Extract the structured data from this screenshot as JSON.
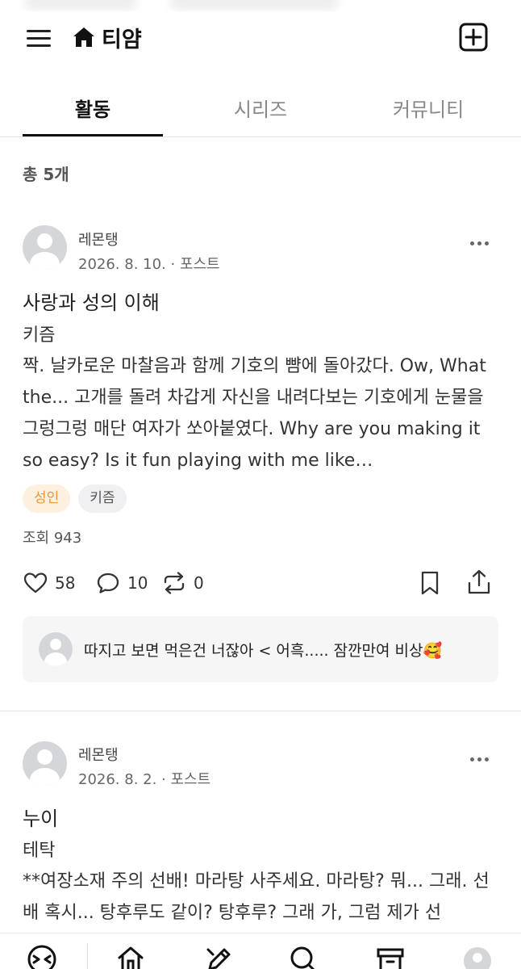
{
  "header": {
    "title": "티얌",
    "menu_icon": "hamburger-menu-icon",
    "home_icon": "home-icon",
    "add_icon": "plus-square-icon"
  },
  "tabs": [
    {
      "label": "활동",
      "active": true
    },
    {
      "label": "시리즈",
      "active": false
    },
    {
      "label": "커뮤니티",
      "active": false
    }
  ],
  "total_label": "총 5개",
  "posts": [
    {
      "author": "레몬탱",
      "meta": "2026. 8. 10. · 포스트",
      "title": "사랑과 성의 이해",
      "subtitle": "키즘",
      "body": "짝. 날카로운 마찰음과 함께 기호의 뺨에 돌아갔다. Ow, What the... 고개를 돌려 차갑게 자신을 내려다보는 기호에게 눈물을 그렁그렁 매단 여자가 쏘아붙였다. Why are you making it so easy? Is it fun playing with me like…",
      "tags": [
        {
          "label": "성인",
          "kind": "adult"
        },
        {
          "label": "키즘",
          "kind": "normal"
        }
      ],
      "views": "조회 943",
      "likes": "58",
      "comments": "10",
      "reposts": "0",
      "comment_preview": "따지고 보면 먹은건 너잖아 < 어흑..... 잠깐만여 비상🥰"
    },
    {
      "author": "레몬탱",
      "meta": "2026. 8. 2. · 포스트",
      "title": "누이",
      "subtitle": "테탁",
      "body": "**여장소재 주의 선배! 마라탕 사주세요. 마라탕? 뭐... 그래. 선배 혹시... 탕후루도 같이? 탕후루? 그래 가, 그럼 제가 선"
    }
  ],
  "bottom_nav": [
    {
      "icon": "feed-face-icon"
    },
    {
      "icon": "home-icon"
    },
    {
      "icon": "write-pen-icon"
    },
    {
      "icon": "search-icon"
    },
    {
      "icon": "archive-box-icon"
    },
    {
      "icon": "profile-avatar-icon"
    }
  ],
  "colors": {
    "adult_tag_bg": "#fdf0de",
    "adult_tag_text": "#e39a3d",
    "active_tab": "#111111",
    "inactive_tab": "#888888"
  }
}
